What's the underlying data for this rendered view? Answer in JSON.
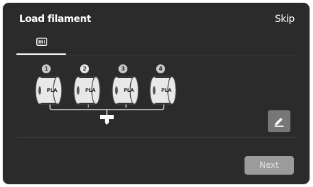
{
  "header": {
    "title": "Load filament",
    "skip_label": "Skip"
  },
  "tabs": [
    {
      "icon": "ams-icon",
      "active": true
    }
  ],
  "slots": [
    {
      "number": "1",
      "material": "PLA",
      "active": false
    },
    {
      "number": "2",
      "material": "PLA",
      "active": true
    },
    {
      "number": "3",
      "material": "PLA",
      "active": false
    },
    {
      "number": "4",
      "material": "PLA",
      "active": false
    }
  ],
  "actions": {
    "edit_icon": "pencil-icon",
    "next_label": "Next"
  },
  "colors": {
    "background": "#2b2b2b",
    "button_disabled": "#9b9b9b",
    "edit_button": "#777777",
    "wire": "#d6d6d6"
  }
}
